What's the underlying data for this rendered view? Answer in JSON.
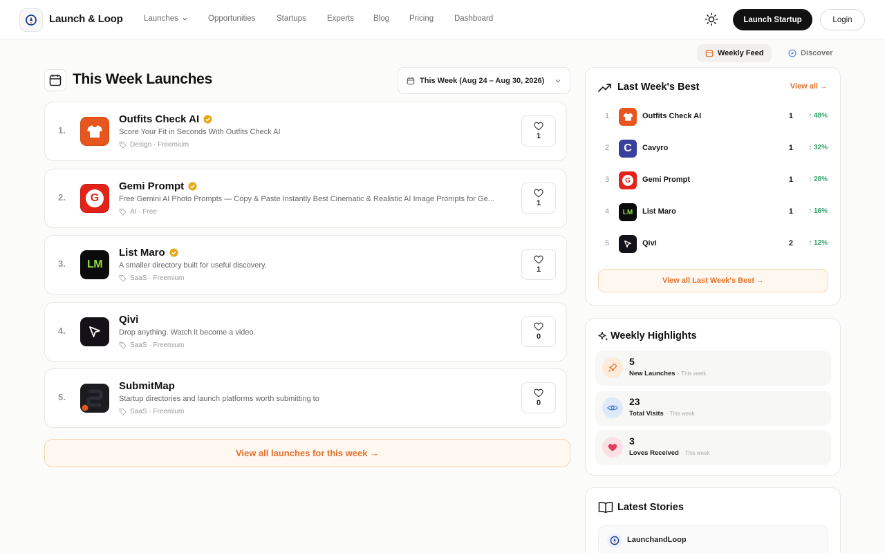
{
  "header": {
    "brand": "Launch & Loop",
    "nav": [
      "Launches",
      "Opportunities",
      "Startups",
      "Experts",
      "Blog",
      "Pricing",
      "Dashboard"
    ],
    "launch_button": "Launch Startup",
    "login_button": "Login"
  },
  "feed_tabs": {
    "weekly": "Weekly Feed",
    "discover": "Discover"
  },
  "main": {
    "title": "This Week Launches",
    "week_select": "This Week (Aug 24 – Aug 30, 2026)",
    "launches": [
      {
        "rank": "1.",
        "name": "Outfits Check AI",
        "desc": "Score Your Fit in Seconds With Outfits Check AI",
        "tags": "Design · Freemium",
        "loves": "1",
        "verified": true,
        "logo_text": ""
      },
      {
        "rank": "2.",
        "name": "Gemi Prompt",
        "desc": "Free Gemini AI Photo Prompts — Copy & Paste Instantly Best Cinematic & Realistic AI Image Prompts for Ge...",
        "tags": "AI · Free",
        "loves": "1",
        "verified": true,
        "logo_text": "G"
      },
      {
        "rank": "3.",
        "name": "List Maro",
        "desc": "A smaller directory built for useful discovery.",
        "tags": "SaaS · Freemium",
        "loves": "1",
        "verified": true,
        "logo_text": "LM"
      },
      {
        "rank": "4.",
        "name": "Qivi",
        "desc": "Drop anything. Watch it become a video.",
        "tags": "SaaS · Freemium",
        "loves": "0",
        "verified": false,
        "logo_text": ""
      },
      {
        "rank": "5.",
        "name": "SubmitMap",
        "desc": "Startup directories and launch platforms worth submitting to",
        "tags": "SaaS · Freemium",
        "loves": "0",
        "verified": false,
        "logo_text": ""
      }
    ],
    "view_all": "View all launches for this week →"
  },
  "last_week_best": {
    "title": "Last Week's Best",
    "view_all": "View all →",
    "items": [
      {
        "rank": "1",
        "name": "Outfits Check AI",
        "count": "1",
        "delta": "↑ 48%",
        "logo_text": ""
      },
      {
        "rank": "2",
        "name": "Cavyro",
        "count": "1",
        "delta": "↑ 32%",
        "logo_text": "C"
      },
      {
        "rank": "3",
        "name": "Gemi Prompt",
        "count": "1",
        "delta": "↑ 28%",
        "logo_text": "G"
      },
      {
        "rank": "4",
        "name": "List Maro",
        "count": "1",
        "delta": "↑ 16%",
        "logo_text": "LM"
      },
      {
        "rank": "5",
        "name": "Qivi",
        "count": "2",
        "delta": "↑ 12%",
        "logo_text": ""
      }
    ],
    "view_all_button": "View all Last Week's Best →"
  },
  "weekly_highlights": {
    "title": "Weekly Highlights",
    "items": [
      {
        "value": "5",
        "label": "New Launches",
        "sub": "· This week",
        "icon": "rocket-icon"
      },
      {
        "value": "23",
        "label": "Total Visits",
        "sub": "· This week",
        "icon": "eye-icon"
      },
      {
        "value": "3",
        "label": "Loves Received",
        "sub": "· This week",
        "icon": "heart-icon"
      }
    ]
  },
  "latest_stories": {
    "title": "Latest Stories",
    "first_author": "LaunchandLoop"
  },
  "colors": {
    "accent": "#e2702a",
    "positive": "#2ea36a",
    "verified": "#e6a817"
  }
}
